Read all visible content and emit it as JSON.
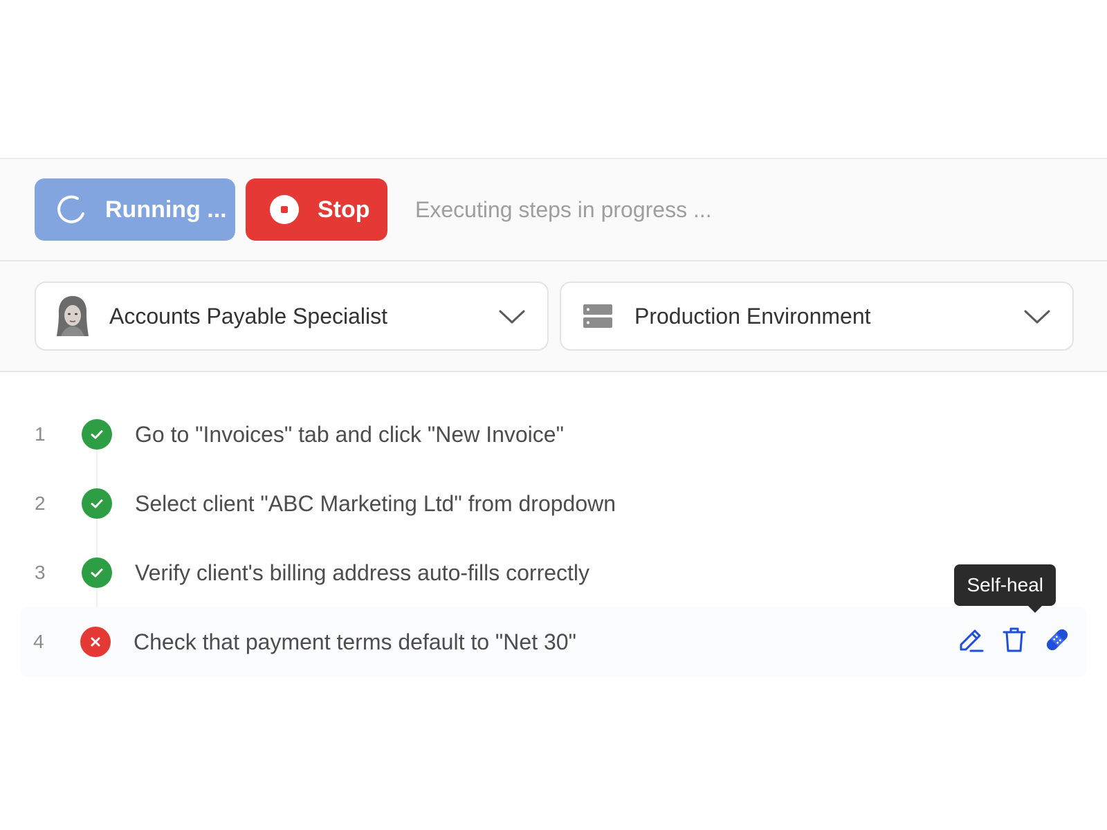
{
  "toolbar": {
    "running_label": "Running ...",
    "stop_label": "Stop",
    "status_text": "Executing steps in progress ...",
    "running_color": "#82a5df",
    "stop_color": "#e53935"
  },
  "selectors": {
    "persona": {
      "label": "Accounts Payable Specialist",
      "icon": "avatar-icon"
    },
    "environment": {
      "label": "Production Environment",
      "icon": "server-icon"
    }
  },
  "steps": [
    {
      "number": "1",
      "text": "Go to \"Invoices\" tab and click \"New Invoice\"",
      "status": "passed"
    },
    {
      "number": "2",
      "text": "Select client \"ABC Marketing Ltd\" from dropdown",
      "status": "passed"
    },
    {
      "number": "3",
      "text": "Verify client's billing address auto-fills correctly",
      "status": "passed"
    },
    {
      "number": "4",
      "text": "Check that payment terms default to \"Net 30\"",
      "status": "failed"
    }
  ],
  "step_actions": {
    "edit_icon": "pencil-icon",
    "delete_icon": "trash-icon",
    "self_heal_icon": "bandage-icon",
    "tooltip": "Self-heal",
    "action_color": "#1d4fd8"
  }
}
